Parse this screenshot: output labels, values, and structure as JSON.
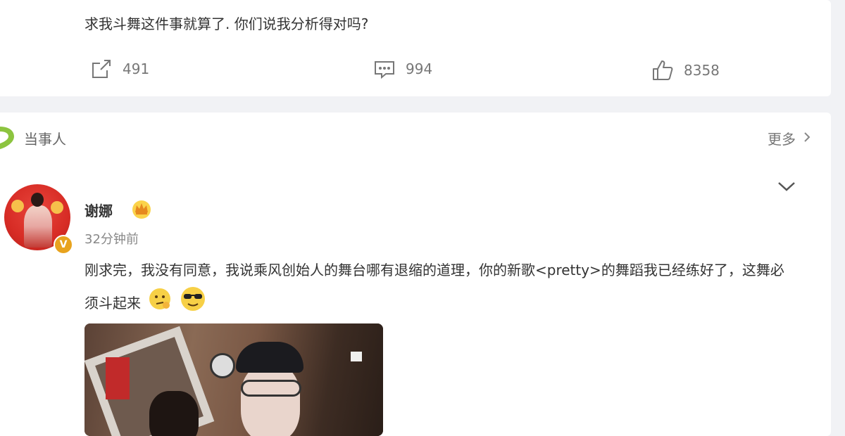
{
  "top_post": {
    "text": "求我斗舞这件事就算了. 你们说我分析得对吗?",
    "actions": {
      "repost_count": "491",
      "comment_count": "994",
      "like_count": "8358"
    }
  },
  "section": {
    "title": "当事人",
    "more_label": "更多",
    "accent_color": "#8cc43f"
  },
  "comment": {
    "username": "谢娜",
    "timestamp": "32分钟前",
    "verified_badge": "V",
    "text": "刚求完，我没有同意，我说乘风创始人的舞台哪有退缩的道理，你的新歌<pretty>的舞蹈我已经练好了，这舞必须斗起来",
    "emojis": [
      "thinking-face-emoji",
      "sunglasses-face-emoji"
    ]
  }
}
